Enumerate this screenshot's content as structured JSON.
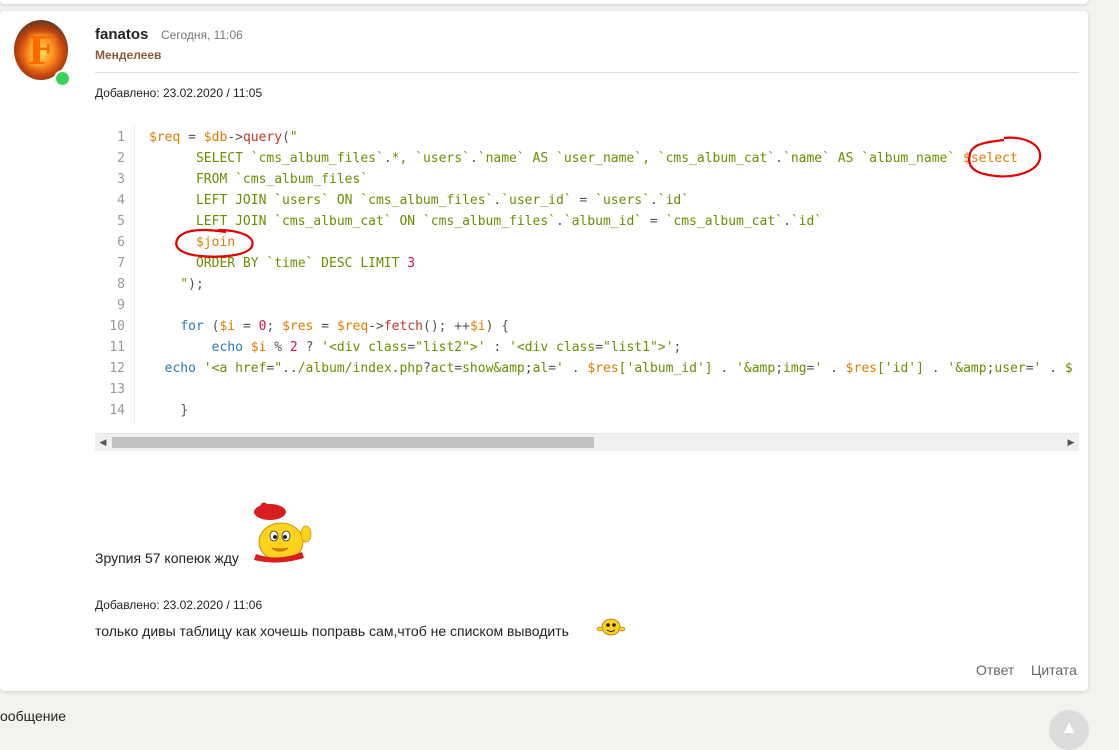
{
  "post": {
    "username": "fanatos",
    "time": "Сегодня, 11:06",
    "rank": "Менделеев",
    "avatar_letter": "F",
    "added_1": "Добавлено: 23.02.2020 / 11:05",
    "added_2": "Добавлено: 23.02.2020 / 11:06",
    "message_1": "Зрупия 57 копеюк жду",
    "message_2": "только дивы таблицу как хочешь поправь сам,чтоб не списком выводить"
  },
  "code": {
    "line_numbers": [
      "1",
      "2",
      "3",
      "4",
      "5",
      "6",
      "7",
      "8",
      "9",
      "10",
      "11",
      "12",
      "13",
      "14"
    ],
    "lines": [
      "$req = $db->query(\"",
      "      SELECT `cms_album_files`.*, `users`.`name` AS `user_name`, `cms_album_cat`.`name` AS `album_name` $select",
      "      FROM `cms_album_files`",
      "      LEFT JOIN `users` ON `cms_album_files`.`user_id` = `users`.`id`",
      "      LEFT JOIN `cms_album_cat` ON `cms_album_files`.`album_id` = `cms_album_cat`.`id`",
      "      $join",
      "      ORDER BY `time` DESC LIMIT 3",
      "    \");",
      "",
      "    for ($i = 0; $res = $req->fetch(); ++$i) {",
      "        echo $i % 2 ? '<div class=\"list2\">' : '<div class=\"list1\">';",
      "  echo '<a href=\"../album/index.php?act=show&amp;al=' . $res['album_id'] . '&amp;img=' . $res['id'] . '&amp;user=' . $",
      "",
      "    }"
    ]
  },
  "scrollbar": {
    "position": 0.0,
    "visible_fraction": 0.49
  },
  "actions": {
    "reply": "Ответ",
    "quote": "Цитата"
  },
  "footer": {
    "bottom_text": "ообщение"
  },
  "colors": {
    "online": "#3ad15a",
    "rank": "#8b5a3c",
    "annotation": "#e00000",
    "code_string": "#6a8e00",
    "code_variable": "#e07b00",
    "code_keyword": "#2a7ab0"
  },
  "icons": {
    "online": "online-status-dot",
    "scroll_left": "chevron-left-icon",
    "scroll_right": "chevron-right-icon",
    "scroll_top": "chevron-up-icon",
    "smiley_1": "chick-smiley-icon",
    "smiley_2": "bouncing-smiley-icon"
  }
}
